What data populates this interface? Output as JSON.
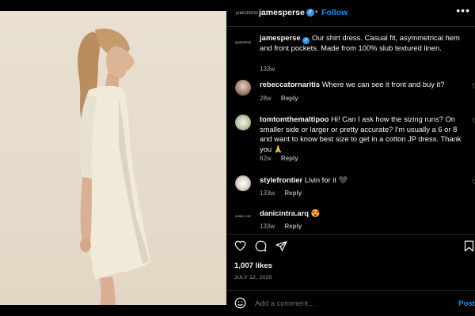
{
  "post": {
    "brand_logo_text": "JAMESPERSE",
    "username": "jamesperse",
    "separator": "•",
    "follow_label": "Follow",
    "more_label": "•••"
  },
  "caption": {
    "username": "jamesperse",
    "text": "Our shirt dress. Casual fit, asymmetrical hem and front pockets. Made from 100% slub textured linen.",
    "time": "133w"
  },
  "comments": [
    {
      "username": "rebeccatornaritis",
      "text": "Where we can see it front and buy it?",
      "time": "28w",
      "reply": "Reply"
    },
    {
      "username": "tomtomthemaltipoo",
      "text": "Hi! Can I ask how the sizing runs? On smaller side or larger or pretty accurate? I'm usually a 6 or 8 and want to know best size to get in a cotton JP dress. Thank you 🙏",
      "time": "62w",
      "reply": "Reply"
    },
    {
      "username": "stylefrontier",
      "text": "Livin for it 🖤",
      "time": "133w",
      "reply": "Reply"
    },
    {
      "username": "danicintra.arq",
      "text": "😍",
      "time": "133w",
      "reply": "Reply",
      "avatar_text": "DANIEL CINTRA"
    }
  ],
  "stats": {
    "likes": "1,007 likes",
    "date": "JULY 12, 2020"
  },
  "compose": {
    "placeholder": "Add a comment...",
    "post_label": "Post"
  },
  "icons": [
    "heart-icon",
    "comment-icon",
    "share-icon",
    "bookmark-icon",
    "emoji-icon",
    "verified-icon"
  ],
  "colors": {
    "accent": "#0095f6",
    "verified": "#3797f0",
    "background": "#000000",
    "muted": "#a8a8a8"
  }
}
